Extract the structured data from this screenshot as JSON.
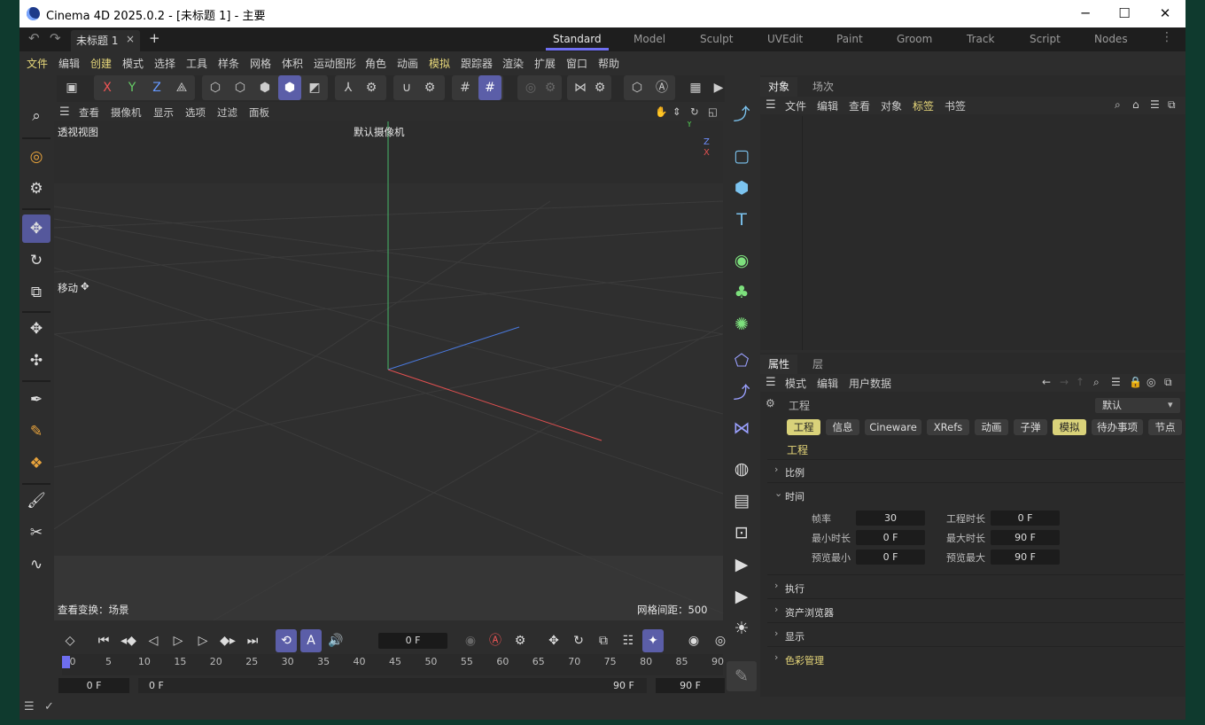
{
  "window": {
    "title": "Cinema 4D 2025.0.2 - [未标题 1] - 主要",
    "minimize": "─",
    "maximize": "☐",
    "close": "✕"
  },
  "doc_tab": {
    "label": "未标题 1",
    "close": "×",
    "add": "+"
  },
  "layouts": [
    "Standard",
    "Model",
    "Sculpt",
    "UVEdit",
    "Paint",
    "Groom",
    "Track",
    "Script",
    "Nodes"
  ],
  "active_layout": "Standard",
  "menu": [
    "文件",
    "编辑",
    "创建",
    "模式",
    "选择",
    "工具",
    "样条",
    "网格",
    "体积",
    "运动图形",
    "角色",
    "动画",
    "模拟",
    "跟踪器",
    "渲染",
    "扩展",
    "窗口",
    "帮助"
  ],
  "toolbar": {
    "x": "X",
    "y": "Y",
    "z": "Z"
  },
  "viewport": {
    "menu": [
      "查看",
      "摄像机",
      "显示",
      "选项",
      "过滤",
      "面板"
    ],
    "name": "透视视图",
    "camera": "默认摄像机",
    "tool": "移动",
    "transform": "查看变换：场景",
    "grid": "网格间距：500 cm",
    "axis_x": "X",
    "axis_y": "Y",
    "axis_z": "Z"
  },
  "timeline": {
    "current": "0 F",
    "ticks": [
      "0",
      "5",
      "10",
      "15",
      "20",
      "25",
      "30",
      "35",
      "40",
      "45",
      "50",
      "55",
      "60",
      "65",
      "70",
      "75",
      "80",
      "85",
      "90"
    ],
    "range_start": "0 F",
    "range_in": "0 F",
    "range_out": "90 F",
    "range_end": "90 F"
  },
  "objects_panel": {
    "tabs": [
      "对象",
      "场次"
    ],
    "menu": [
      "文件",
      "编辑",
      "查看",
      "对象",
      "标签",
      "书签"
    ]
  },
  "attributes_panel": {
    "tabs": [
      "属性",
      "层"
    ],
    "menu": [
      "模式",
      "编辑",
      "用户数据"
    ],
    "mode": "工程",
    "preset": "默认",
    "chips": [
      "工程",
      "信息",
      "Cineware",
      "XRefs",
      "动画",
      "子弹",
      "模拟",
      "待办事项",
      "节点"
    ],
    "heading": "工程",
    "sections": {
      "scale": "比例",
      "time": "时间",
      "exec": "执行",
      "asset": "资产浏览器",
      "display": "显示",
      "color": "色彩管理"
    },
    "fields": {
      "fps_label": "帧率",
      "fps": "30",
      "duration_label": "工程时长",
      "duration": "0 F",
      "min_label": "最小时长",
      "min": "0 F",
      "max_label": "最大时长",
      "max": "90 F",
      "pmin_label": "预览最小",
      "pmin": "0 F",
      "pmax_label": "预览最大",
      "pmax": "90 F"
    }
  },
  "colors": {
    "accent": "#5b5ea8",
    "highlight": "#e8d87a",
    "axis_x": "#e05050",
    "axis_y": "#50c050",
    "axis_z": "#4a7ae0"
  }
}
